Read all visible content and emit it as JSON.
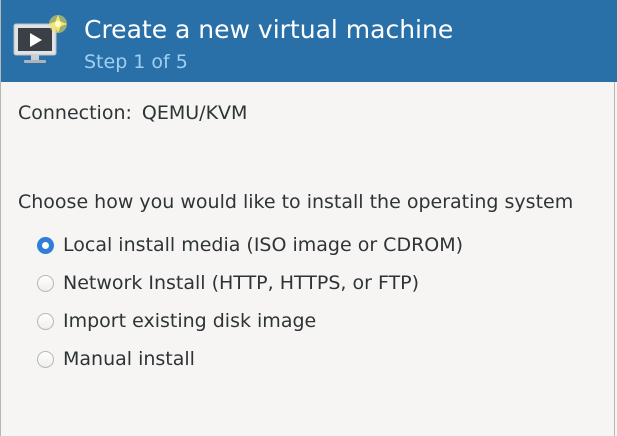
{
  "header": {
    "title": "Create a new virtual machine",
    "step": "Step 1 of 5",
    "icon": "virtual-machine-new-icon",
    "background_color": "#2a70a8",
    "step_color": "#9fd0f3"
  },
  "connection": {
    "label": "Connection:",
    "value": "QEMU/KVM"
  },
  "install": {
    "prompt": "Choose how you would like to install the operating system",
    "options": [
      {
        "label": "Local install media (ISO image or CDROM)",
        "selected": true
      },
      {
        "label": "Network Install (HTTP, HTTPS, or FTP)",
        "selected": false
      },
      {
        "label": "Import existing disk image",
        "selected": false
      },
      {
        "label": "Manual install",
        "selected": false
      }
    ],
    "accent_color": "#2f7ed8"
  }
}
